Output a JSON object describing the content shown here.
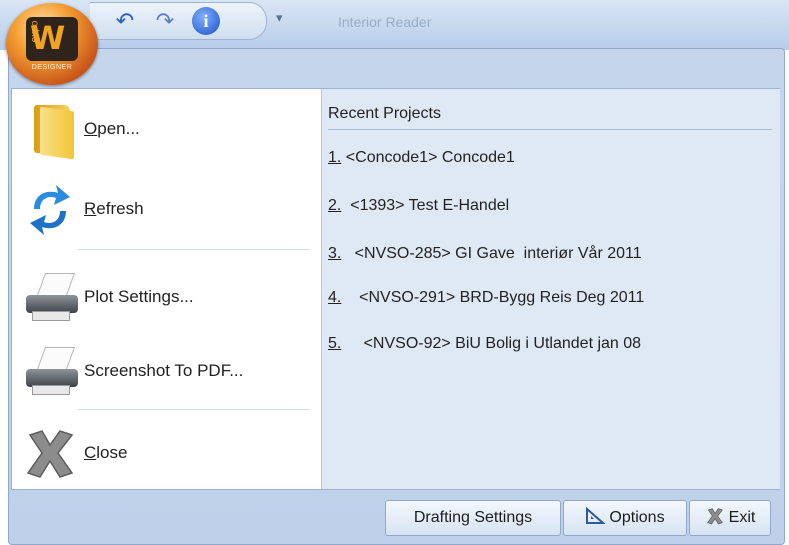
{
  "titlebar": {
    "app_title": "Interior Reader",
    "logo": {
      "letter": "W",
      "top_text": "expo",
      "bottom_text": "DESIGNER"
    },
    "quick_access": [
      {
        "icon": "undo-icon",
        "glyph": "↶"
      },
      {
        "icon": "redo-icon",
        "glyph": "↷"
      },
      {
        "icon": "info-icon",
        "glyph": "i"
      }
    ],
    "customize_glyph": "▾"
  },
  "menu": {
    "items": [
      {
        "id": "open",
        "label": "Open...",
        "icon": "folder-icon"
      },
      {
        "id": "refresh",
        "label": "Refresh",
        "icon": "refresh-icon"
      },
      {
        "id": "plot",
        "label": "Plot Settings...",
        "icon": "printer-icon"
      },
      {
        "id": "pdf",
        "label": "Screenshot To PDF...",
        "icon": "printer-icon"
      },
      {
        "id": "close",
        "label": "Close",
        "icon": "close-icon"
      }
    ]
  },
  "recent": {
    "title": "Recent Projects",
    "items": [
      {
        "num": "1.",
        "text": " <Concode1> Concode1"
      },
      {
        "num": "2.",
        "text": "  <1393> Test E-Handel"
      },
      {
        "num": "3.",
        "text": "   <NVSO-285> GI Gave  interiør Vår 2011"
      },
      {
        "num": "4.",
        "text": "    <NVSO-291> BRD-Bygg Reis Deg 2011"
      },
      {
        "num": "5.",
        "text": "     <NVSO-92> BiU Bolig i Utlandet jan 08"
      }
    ]
  },
  "footer": {
    "drafting_settings": "Drafting Settings",
    "options": "Options",
    "exit": "Exit"
  }
}
